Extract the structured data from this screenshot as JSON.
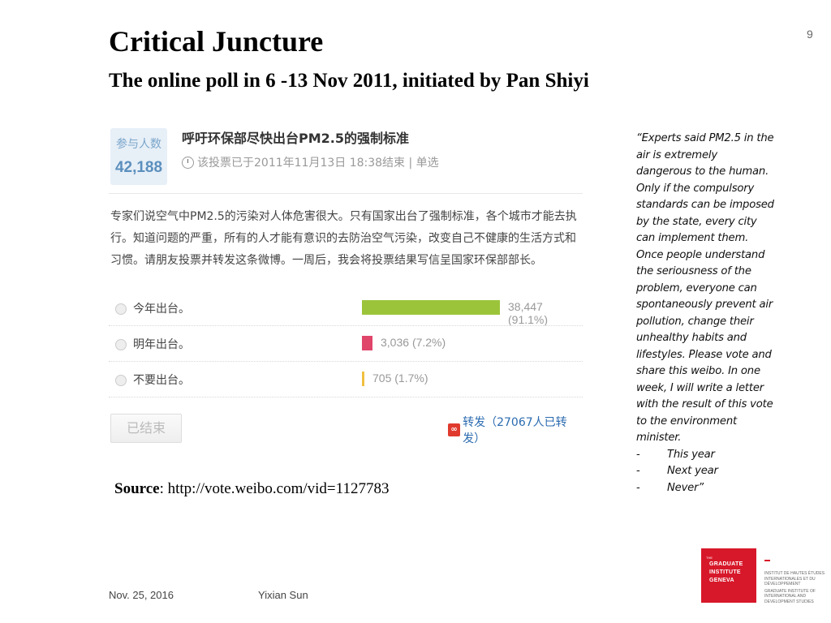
{
  "slide": {
    "title": "Critical Juncture",
    "subtitle": "The online poll in 6 -13 Nov 2011, initiated by Pan Shiyi",
    "page_number": "9"
  },
  "poll": {
    "participants_label": "参与人数",
    "participants_count": "42,188",
    "title": "呼吁环保部尽快出台PM2.5的强制标准",
    "meta": "该投票已于2011年11月13日 18:38结束 | 单选",
    "description": "专家们说空气中PM2.5的污染对人体危害很大。只有国家出台了强制标准，各个城市才能去执行。知道问题的严重，所有的人才能有意识的去防治空气污染，改变自己不健康的生活方式和习惯。请朋友投票并转发这条微博。一周后，我会将投票结果写信呈国家环保部部长。",
    "options": [
      {
        "label": "今年出台。",
        "votes": "38,447",
        "percent_text": "(91.1%)",
        "percent": 91.1,
        "color": "#9cc43a"
      },
      {
        "label": "明年出台。",
        "votes": "3,036",
        "percent_text": "(7.2%)",
        "percent": 7.2,
        "color": "#e0456a"
      },
      {
        "label": "不要出台。",
        "votes": "705",
        "percent_text": "(1.7%)",
        "percent": 1.7,
        "color": "#f0c040"
      }
    ],
    "ended_button": "已结束",
    "share_label": "转发（27067人已转发）"
  },
  "source": {
    "label": "Source",
    "text": ": http://vote.weibo.com/vid=1127783"
  },
  "quote": {
    "text": "“Experts said PM2.5 in the air is extremely dangerous to the human. Only if the compulsory standards can be imposed by the state, every city can implement them. Once people understand the seriousness of the problem, everyone can spontaneously prevent air pollution, change their unhealthy habits and lifestyles. Please vote and share this weibo. In one week, I will write a letter with the result of this vote to the environment minister.",
    "items": [
      "This year",
      "Next year",
      "Never”"
    ]
  },
  "footer": {
    "date": "Nov. 25, 2016",
    "author": "Yixian Sun"
  },
  "logo": {
    "the": "THE",
    "line1": "GRADUATE",
    "line2": "INSTITUTE",
    "line3": "GENEVA",
    "text_fr": "INSTITUT DE HAUTES ÉTUDES INTERNATIONALES ET DU DÉVELOPPEMENT",
    "text_en": "GRADUATE INSTITUTE OF INTERNATIONAL AND DEVELOPMENT STUDIES"
  }
}
